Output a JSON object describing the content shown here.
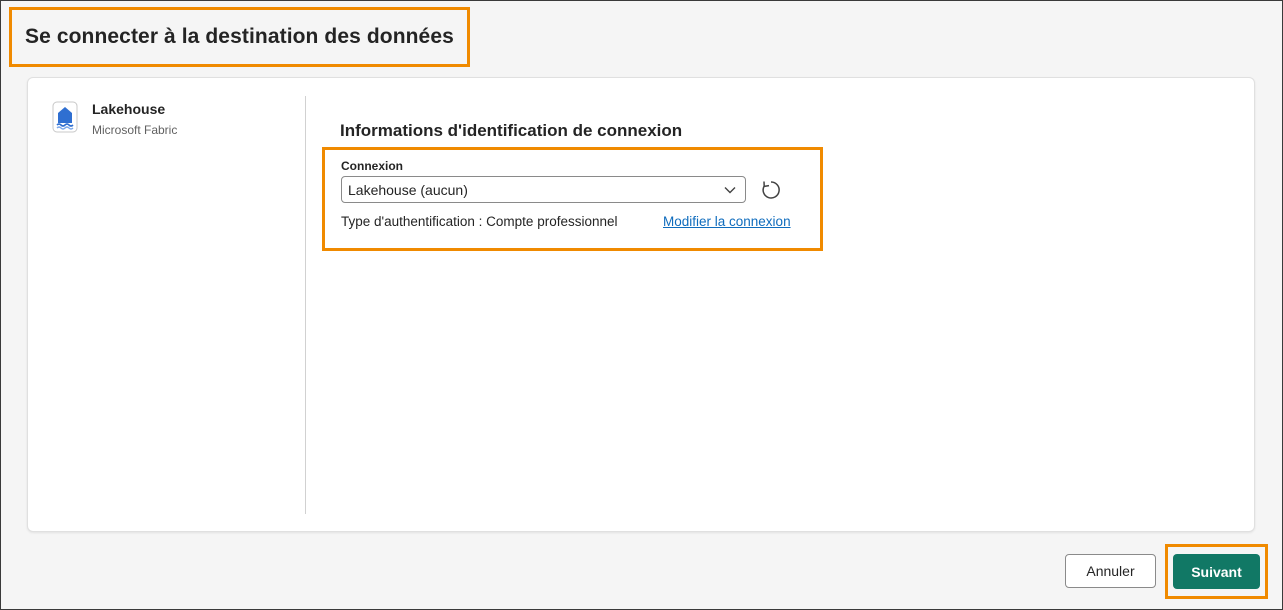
{
  "header": {
    "title": "Se connecter à la destination des données"
  },
  "sidebar": {
    "items": [
      {
        "name": "Lakehouse",
        "subtitle": "Microsoft Fabric",
        "icon": "lakehouse-icon"
      }
    ]
  },
  "main": {
    "section_title": "Informations d'identification de connexion",
    "connection": {
      "label": "Connexion",
      "selected_value": "Lakehouse (aucun)",
      "auth_text": "Type d'authentification : Compte professionnel",
      "modify_link": "Modifier la connexion"
    }
  },
  "footer": {
    "cancel_label": "Annuler",
    "next_label": "Suivant"
  },
  "colors": {
    "accent_highlight": "#f08a00",
    "primary_button": "#117865",
    "link": "#0f6cbd",
    "icon_blue": "#2f6fd1"
  }
}
